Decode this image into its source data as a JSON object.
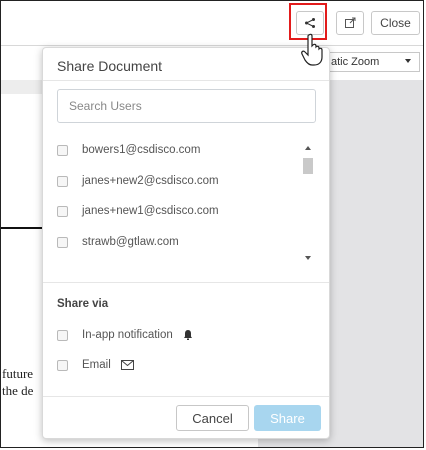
{
  "toolbar": {
    "close_label": "Close"
  },
  "viewer": {
    "zoom_value": "atic Zoom",
    "doc_text": [
      "future",
      "the de"
    ]
  },
  "share_dialog": {
    "title": "Share Document",
    "search_placeholder": "Search Users",
    "users": [
      {
        "email": "bowers1@csdisco.com",
        "checked": false
      },
      {
        "email": "janes+new2@csdisco.com",
        "checked": false
      },
      {
        "email": "janes+new1@csdisco.com",
        "checked": false
      },
      {
        "email": "strawb@gtlaw.com",
        "checked": false
      }
    ],
    "share_via_heading": "Share via",
    "share_via_options": [
      {
        "label": "In-app notification",
        "icon": "bell-icon",
        "checked": false
      },
      {
        "label": "Email",
        "icon": "envelope-icon",
        "checked": false
      }
    ],
    "cancel_label": "Cancel",
    "submit_label": "Share"
  },
  "colors": {
    "highlight": "#e21b1b",
    "share_button_disabled": "#a8d6ef"
  }
}
